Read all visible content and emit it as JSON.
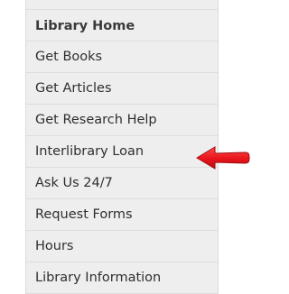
{
  "nav": {
    "items": [
      {
        "label": "Library Home",
        "bold": true
      },
      {
        "label": "Get Books"
      },
      {
        "label": "Get Articles"
      },
      {
        "label": "Get Research Help"
      },
      {
        "label": "Interlibrary Loan",
        "highlighted": true
      },
      {
        "label": "Ask Us 24/7"
      },
      {
        "label": "Request Forms"
      },
      {
        "label": "Hours"
      },
      {
        "label": "Library Information"
      }
    ]
  },
  "annotation": {
    "arrow_icon": "left-arrow-icon",
    "arrow_color": "#e8141b"
  }
}
